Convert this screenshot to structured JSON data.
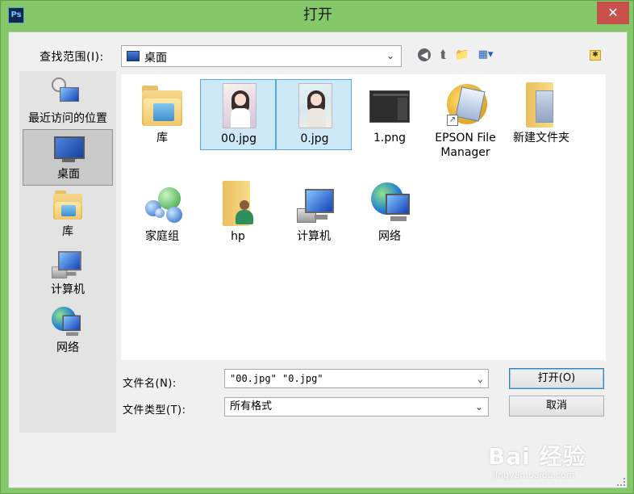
{
  "window": {
    "title": "打开",
    "app_icon_text": "Ps",
    "close_glyph": "✕"
  },
  "toolbar": {
    "look_in_label": "查找范围(I):",
    "look_in_value": "桌面",
    "back_glyph": "◀",
    "up_glyph": "⮬",
    "newfolder_glyph": "📁",
    "view_glyph": "▦▾",
    "corner_glyph": "✱"
  },
  "places": [
    {
      "label": "最近访问的位置",
      "icon": "recent-places-icon"
    },
    {
      "label": "桌面",
      "icon": "desktop-icon",
      "selected": true
    },
    {
      "label": "库",
      "icon": "library-icon"
    },
    {
      "label": "计算机",
      "icon": "computer-icon"
    },
    {
      "label": "网络",
      "icon": "network-icon"
    }
  ],
  "files": [
    {
      "label": "库",
      "icon": "library-folder-icon"
    },
    {
      "label": "00.jpg",
      "icon": "image-thumbnail-icon",
      "selected": true
    },
    {
      "label": "0.jpg",
      "icon": "image-thumbnail-icon",
      "selected": true
    },
    {
      "label": "1.png",
      "icon": "screenshot-thumbnail-icon"
    },
    {
      "label": "EPSON File Manager",
      "icon": "epson-shortcut-icon"
    },
    {
      "label": "新建文件夹",
      "icon": "folder-icon"
    },
    {
      "label": "家庭组",
      "icon": "homegroup-icon"
    },
    {
      "label": "hp",
      "icon": "user-folder-icon"
    },
    {
      "label": "计算机",
      "icon": "computer-icon"
    },
    {
      "label": "网络",
      "icon": "network-icon"
    }
  ],
  "form": {
    "filename_label": "文件名(N):",
    "filename_value": "\"00.jpg\" \"0.jpg\"",
    "filetype_label": "文件类型(T):",
    "filetype_value": "所有格式",
    "open_button": "打开(O)",
    "cancel_button": "取消",
    "chevron_glyph": "⌄"
  },
  "watermark": {
    "logo": "Bai 经验",
    "sub": "jingyan.baidu.com"
  }
}
